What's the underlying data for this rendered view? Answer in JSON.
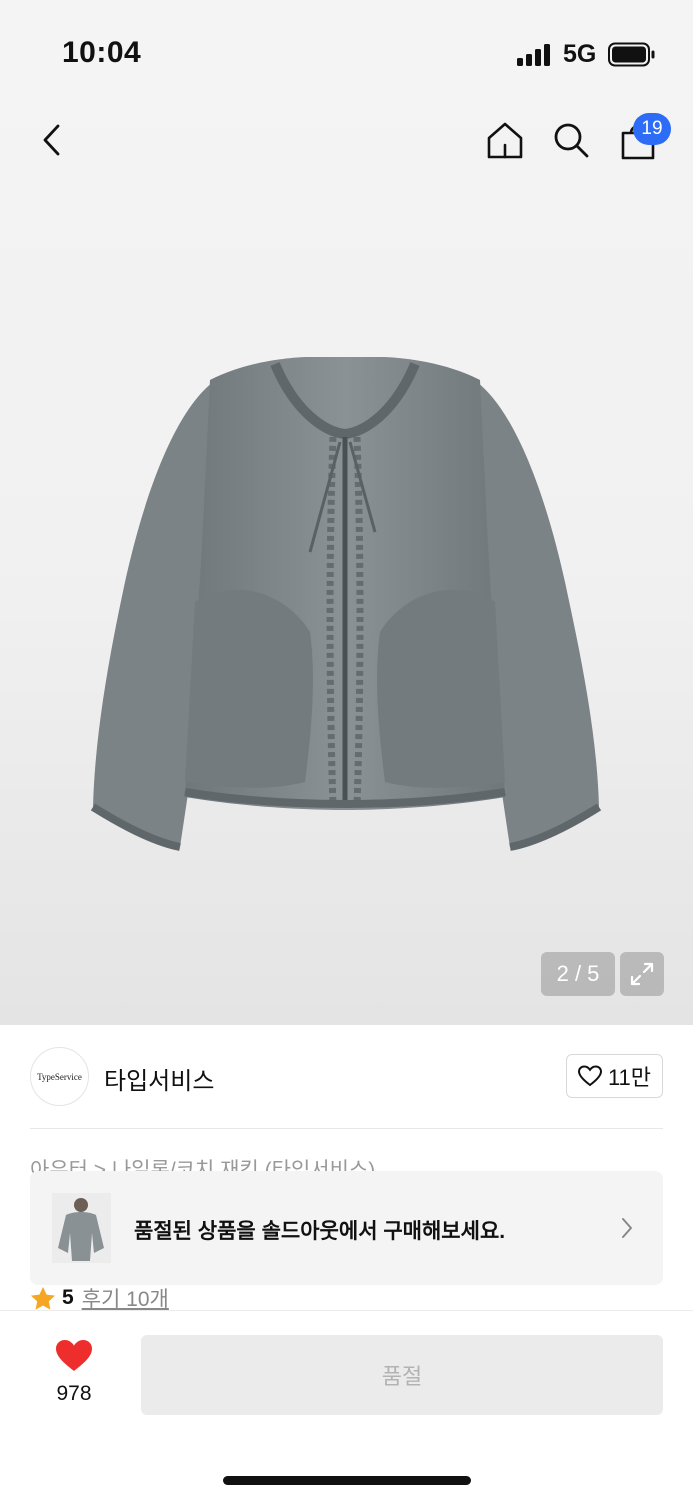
{
  "status": {
    "time": "10:04",
    "network": "5G"
  },
  "header": {
    "cart_count": "19",
    "icons": [
      "back-icon",
      "home-icon",
      "search-icon",
      "cart-icon"
    ]
  },
  "gallery": {
    "counter": "2 / 5",
    "product_image": "gray-nylon-shirring-zip-jacket"
  },
  "brand": {
    "logo_text": "TypeService",
    "name": "타입서비스",
    "like_count": "11만"
  },
  "breadcrumb": "아우터 > 나일론/코치 재킷 (타입서비스)",
  "soldout_banner": {
    "text": "품절된 상품을 솔드아웃에서 구매해보세요."
  },
  "rating": {
    "score": "5",
    "review_text": "후기 10개"
  },
  "bottom_bar": {
    "wish_count": "978",
    "buy_label": "품절"
  },
  "colors": {
    "accent_badge": "#2d6cf6",
    "heart": "#ee2d2d",
    "star": "#f5a623",
    "jacket": "#7f878a"
  }
}
